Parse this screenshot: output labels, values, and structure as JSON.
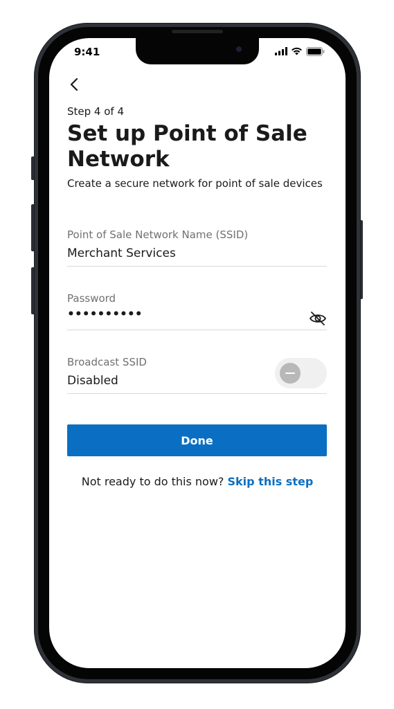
{
  "status_bar": {
    "time": "9:41",
    "icons": [
      "signal-icon",
      "wifi-icon",
      "battery-icon"
    ]
  },
  "header": {
    "back_icon": "chevron-left-icon",
    "step": "Step 4 of 4",
    "title": "Set up Point of Sale Network",
    "subtitle": "Create a secure network for point of sale devices"
  },
  "form": {
    "ssid": {
      "label": "Point of Sale Network Name (SSID)",
      "value": "Merchant Services"
    },
    "password": {
      "label": "Password",
      "value": "••••••••••",
      "toggle_icon": "eye-off-icon"
    },
    "broadcast": {
      "label": "Broadcast SSID",
      "value": "Disabled",
      "enabled": false
    }
  },
  "actions": {
    "done_label": "Done",
    "skip_prompt": "Not ready to do this now?",
    "skip_link": "Skip this step"
  },
  "colors": {
    "accent": "#0a6fc2",
    "text": "#1a1a1a",
    "label": "#707070",
    "divider": "#d9d9d9"
  }
}
